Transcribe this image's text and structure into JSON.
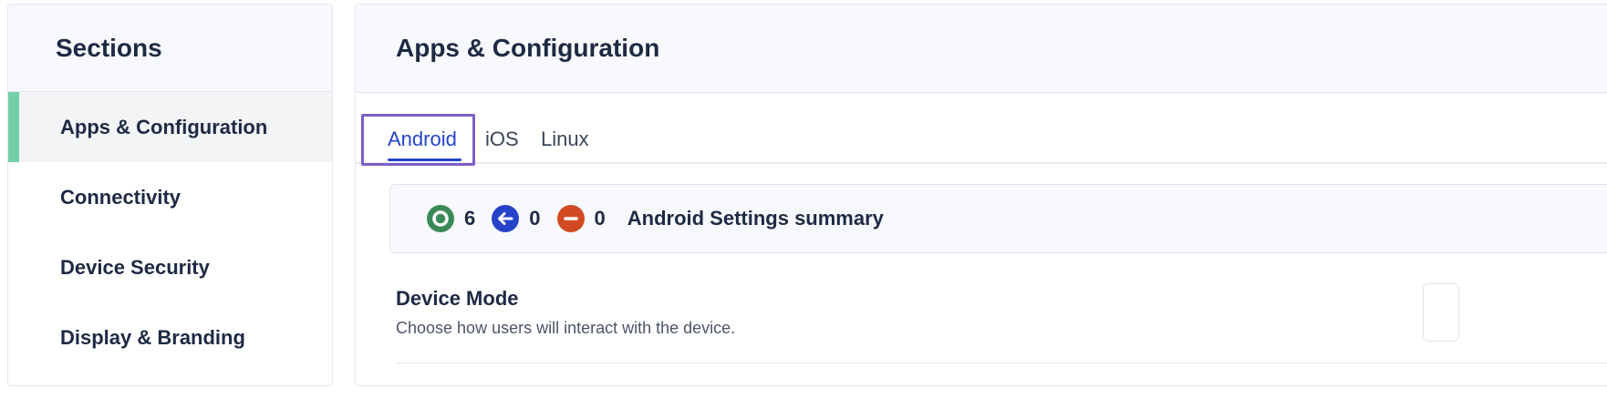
{
  "sidebar": {
    "title": "Sections",
    "items": [
      {
        "label": "Apps & Configuration",
        "active": true
      },
      {
        "label": "Connectivity",
        "active": false
      },
      {
        "label": "Device Security",
        "active": false
      },
      {
        "label": "Display & Branding",
        "active": false
      }
    ]
  },
  "main": {
    "title": "Apps & Configuration",
    "tabs": [
      {
        "label": "Android",
        "active": true
      },
      {
        "label": "iOS",
        "active": false
      },
      {
        "label": "Linux",
        "active": false
      }
    ],
    "summary": {
      "stats": [
        {
          "icon": "check-circle-icon",
          "count": "6",
          "color": "#3a8a57"
        },
        {
          "icon": "arrow-left-icon",
          "count": "0",
          "color": "#2543c9"
        },
        {
          "icon": "minus-circle-icon",
          "count": "0",
          "color": "#d24a22"
        }
      ],
      "label": "Android Settings summary"
    },
    "setting": {
      "title": "Device Mode",
      "description": "Choose how users will interact with the device."
    }
  },
  "colors": {
    "accent": "#2543c9",
    "active_indicator": "#73cfa6",
    "focus_ring": "#7c5ec7"
  }
}
